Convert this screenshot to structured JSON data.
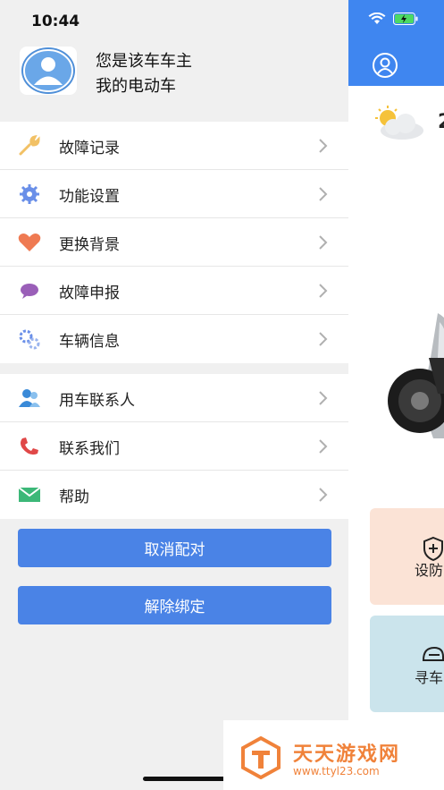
{
  "status_bar": {
    "time": "10:44"
  },
  "drawer": {
    "owner_text": "您是该车车主",
    "vehicle_text": "我的电动车",
    "menu_group_1": [
      {
        "label": "故障记录",
        "icon": "wrench-icon",
        "color": "#f2c165"
      },
      {
        "label": "功能设置",
        "icon": "gear-icon",
        "color": "#6a8fe8"
      },
      {
        "label": "更换背景",
        "icon": "heart-icon",
        "color": "#ef7a52"
      },
      {
        "label": "故障申报",
        "icon": "chat-bubble-icon",
        "color": "#9a5fb8"
      },
      {
        "label": "车辆信息",
        "icon": "gears-icon",
        "color": "#6a8fe8"
      }
    ],
    "menu_group_2": [
      {
        "label": "用车联系人",
        "icon": "contacts-icon",
        "color": "#3a8ad8"
      },
      {
        "label": "联系我们",
        "icon": "phone-icon",
        "color": "#e04848"
      },
      {
        "label": "帮助",
        "icon": "mail-icon",
        "color": "#3cb878"
      }
    ],
    "buttons": {
      "cancel_pair": "取消配对",
      "unbind": "解除绑定"
    }
  },
  "background_app": {
    "temp_partial": "2",
    "card_arm_label": "设防",
    "card_find_label": "寻车"
  },
  "watermark": {
    "title": "天天游戏网",
    "url": "www.ttyl23.com"
  },
  "colors": {
    "accent": "#3f86f0",
    "button": "#4a83e6",
    "watermark": "#f0823a"
  }
}
